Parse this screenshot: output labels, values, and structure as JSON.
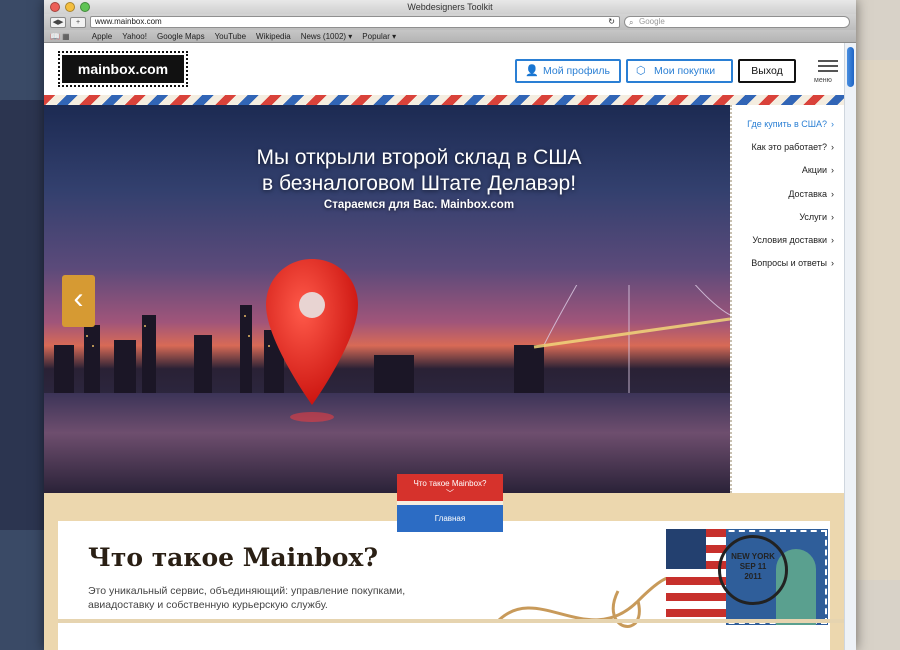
{
  "window": {
    "title": "Webdesigners Toolkit",
    "url": "www.mainbox.com",
    "search_placeholder": "Google"
  },
  "bookmarks": [
    "Apple",
    "Yahoo!",
    "Google Maps",
    "YouTube",
    "Wikipedia",
    "News (1002) ▾",
    "Popular ▾"
  ],
  "header": {
    "logo": "mainbox.com",
    "profile_label": "Мой профиль",
    "orders_label": "Мои покупки",
    "exit_label": "Выход",
    "menu_label": "меню"
  },
  "hero": {
    "title_line1": "Мы открыли второй склад в США",
    "title_line2": "в безналоговом Штате Делавэр!",
    "subtitle": "Стараемся для Вас. Mainbox.com"
  },
  "side_nav": {
    "items": [
      {
        "label": "Где купить в США?",
        "active": true
      },
      {
        "label": "Как это работает?",
        "active": false
      },
      {
        "label": "Акции",
        "active": false
      },
      {
        "label": "Доставка",
        "active": false
      },
      {
        "label": "Услуги",
        "active": false
      },
      {
        "label": "Условия доставки",
        "active": false
      },
      {
        "label": "Вопросы и ответы",
        "active": false
      }
    ]
  },
  "tab_badge": {
    "top_label": "Что такое Mainbox?",
    "bottom_label": "Главная"
  },
  "about": {
    "title": "Что такое Mainbox?",
    "text": "Это уникальный сервис, объединяющий: управление покупками, авиадоставку и собственную курьерскую службу."
  },
  "stamp": {
    "postmark_line1": "NEW YORK",
    "postmark_line2": "SEP 11",
    "postmark_line3": "2011"
  },
  "colors": {
    "accent": "#2a7fd4",
    "airmail_red": "#d9423a",
    "airmail_blue": "#3165b6",
    "slider_arrow": "#d69a33"
  }
}
